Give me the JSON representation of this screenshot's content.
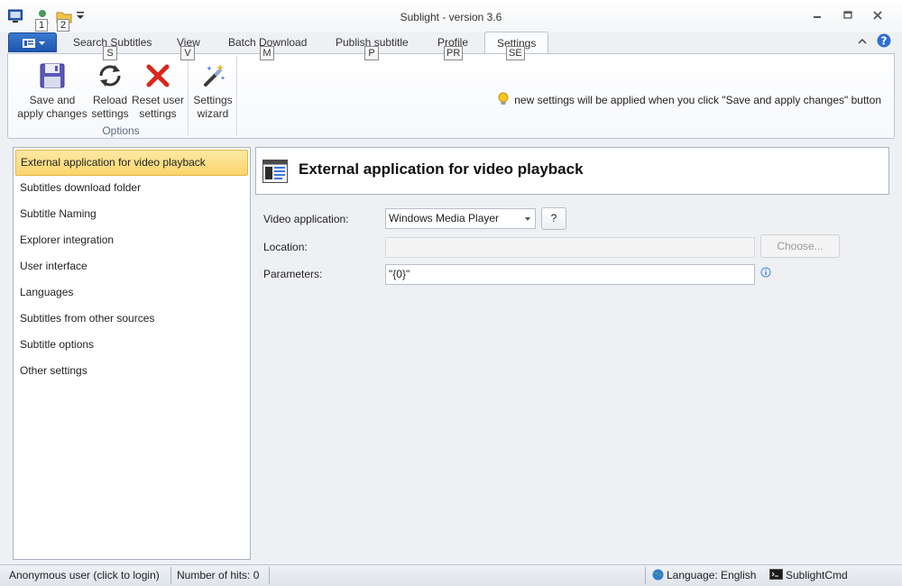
{
  "window": {
    "title": "Sublight - version 3.6"
  },
  "quick_access": {
    "badges": [
      "1",
      "2"
    ]
  },
  "ribbon_tabs": [
    {
      "label": "Search Subtitles",
      "key": "S"
    },
    {
      "label": "View",
      "key": "V"
    },
    {
      "label": "Batch Download",
      "key": "M"
    },
    {
      "label": "Publish subtitle",
      "key": "P"
    },
    {
      "label": "Profile",
      "key": "PR"
    },
    {
      "label": "Settings",
      "key": "SE",
      "active": true
    }
  ],
  "ribbon": {
    "buttons": [
      {
        "line1": "Save and",
        "line2": "apply changes",
        "icon": "floppy-disk-icon"
      },
      {
        "line1": "Reload",
        "line2": "settings",
        "icon": "refresh-icon"
      },
      {
        "line1": "Reset user",
        "line2": "settings",
        "icon": "red-x-icon"
      },
      {
        "line1": "Settings",
        "line2": "wizard",
        "icon": "magic-wand-icon"
      }
    ],
    "group_label": "Options",
    "info_message": "new settings will be applied when you click \"Save and apply changes\" button"
  },
  "nav": {
    "items": [
      "External application for video playback",
      "Subtitles download folder",
      "Subtitle Naming",
      "Explorer integration",
      "User interface",
      "Languages",
      "Subtitles from other sources",
      "Subtitle options",
      "Other settings"
    ],
    "selected_index": 0
  },
  "content": {
    "title": "External application for video playback",
    "video_application_label": "Video application:",
    "video_application_value": "Windows Media Player",
    "help_button": "?",
    "location_label": "Location:",
    "location_value": "",
    "choose_button": "Choose...",
    "parameters_label": "Parameters:",
    "parameters_value": "\"{0}\""
  },
  "statusbar": {
    "user": "Anonymous user (click to login)",
    "hits": "Number of hits: 0",
    "language": "Language: English",
    "cmd": "SublightCmd"
  },
  "colors": {
    "accent_blue": "#1f56ad",
    "selection_yellow": "#fbd56a"
  }
}
